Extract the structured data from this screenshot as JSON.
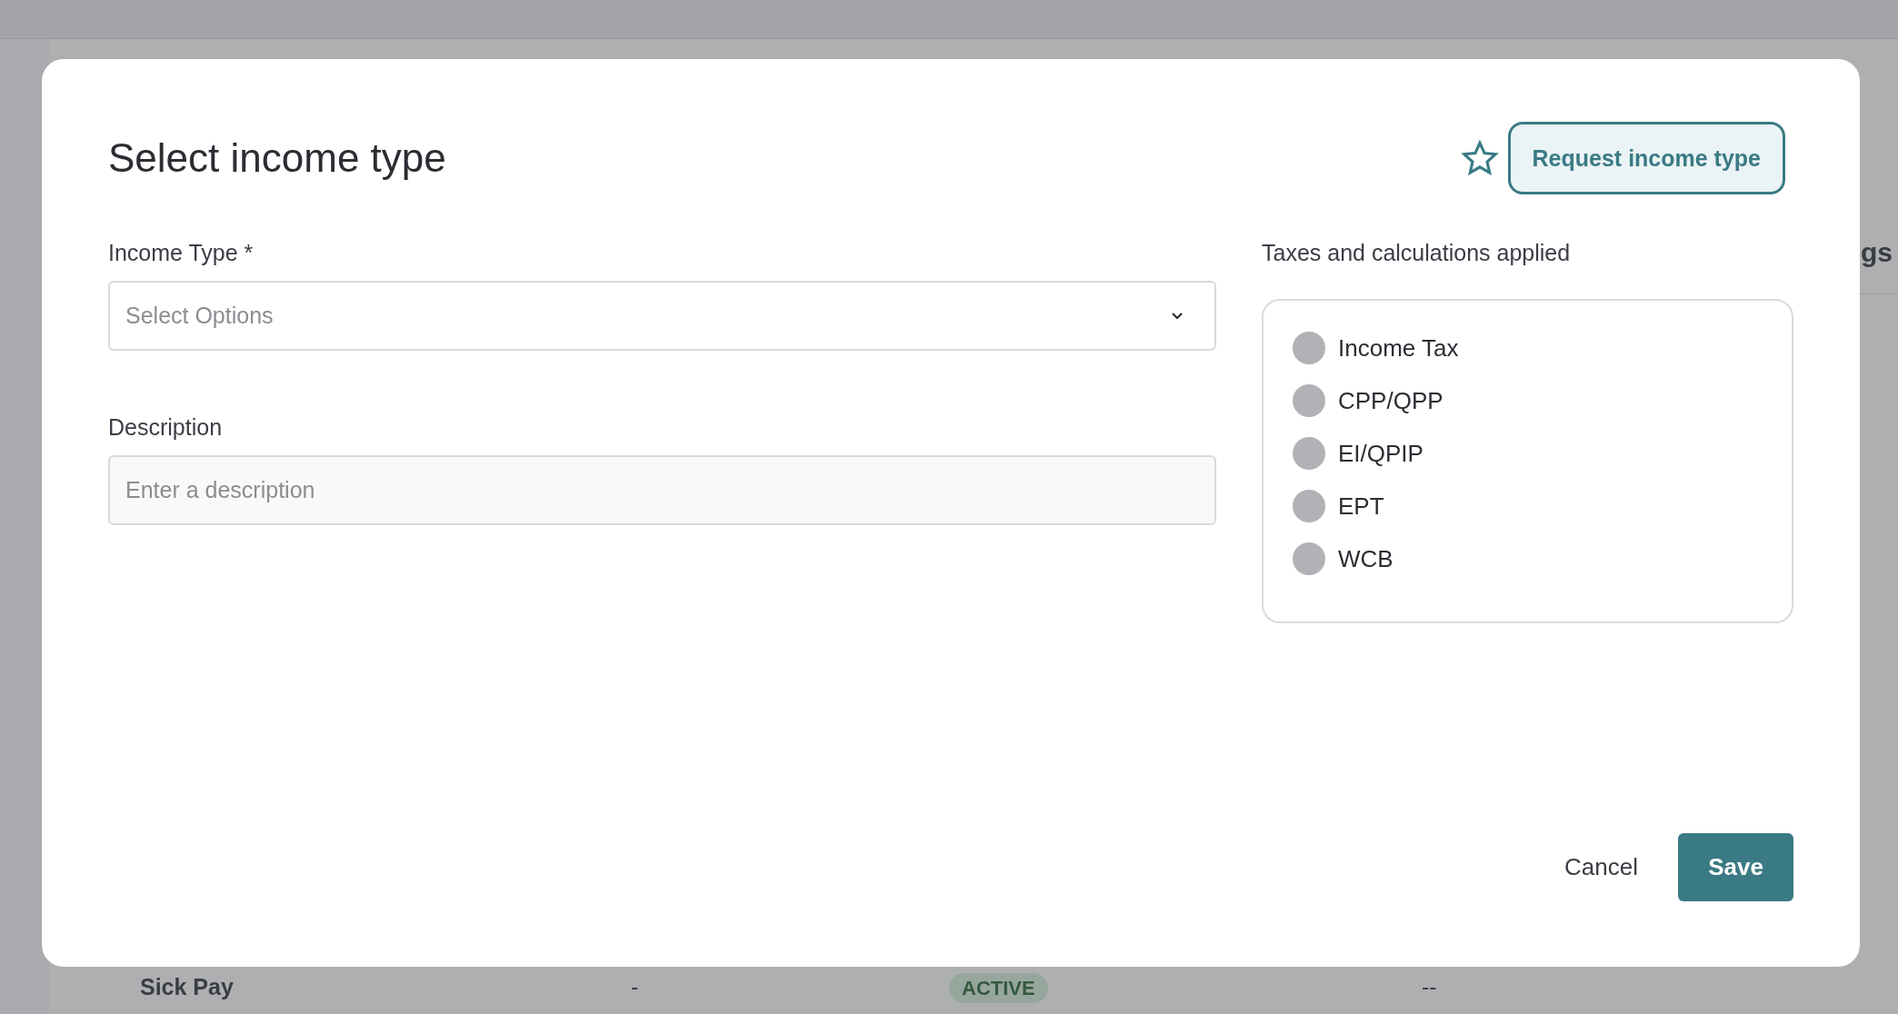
{
  "background": {
    "column_heading": "gs",
    "row": {
      "name": "Sick Pay",
      "column_2": "-",
      "status": "ACTIVE",
      "column_4": "--"
    }
  },
  "dialog": {
    "title": "Select income type",
    "request_button": "Request income type",
    "income_type": {
      "label": "Income Type *",
      "placeholder": "Select Options"
    },
    "description": {
      "label": "Description",
      "placeholder": "Enter a description"
    },
    "taxes": {
      "label": "Taxes and calculations applied",
      "items": [
        {
          "label": "Income Tax",
          "on": false
        },
        {
          "label": "CPP/QPP",
          "on": false
        },
        {
          "label": "EI/QPIP",
          "on": false
        },
        {
          "label": "EPT",
          "on": false
        },
        {
          "label": "WCB",
          "on": false
        }
      ]
    },
    "buttons": {
      "cancel": "Cancel",
      "save": "Save"
    }
  }
}
